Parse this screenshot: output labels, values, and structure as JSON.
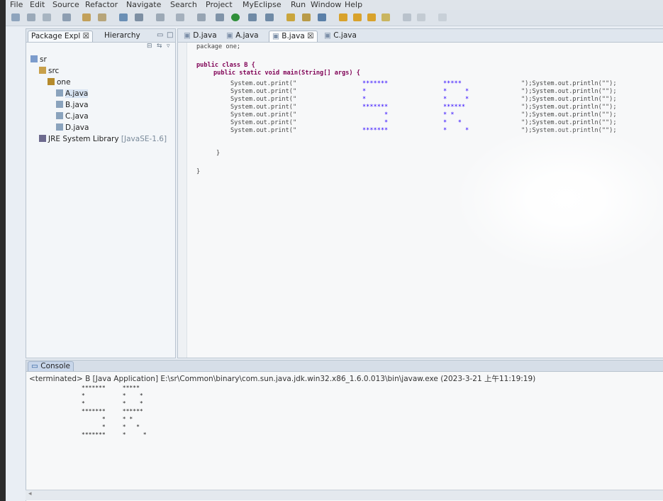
{
  "menubar": [
    "File",
    "Edit",
    "Source",
    "Refactor",
    "Navigate",
    "Search",
    "Project",
    "MyEclipse",
    "Run",
    "Window",
    "Help"
  ],
  "left_panel": {
    "tabs": [
      "Package Expl",
      "Hierarchy"
    ],
    "tree": [
      {
        "label": "sr",
        "icon": "project-icon",
        "indent": 0
      },
      {
        "label": "src",
        "icon": "source-folder-icon",
        "indent": 1
      },
      {
        "label": "one",
        "icon": "package-icon",
        "indent": 2
      },
      {
        "label": "A.java",
        "icon": "java-file-icon",
        "indent": 3,
        "selected": true
      },
      {
        "label": "B.java",
        "icon": "java-file-icon",
        "indent": 3
      },
      {
        "label": "C.java",
        "icon": "java-file-icon",
        "indent": 3
      },
      {
        "label": "D.java",
        "icon": "java-file-icon",
        "indent": 3
      },
      {
        "label": "JRE System Library",
        "suffix": "[JavaSE-1.6]",
        "icon": "library-icon",
        "indent": 1
      }
    ]
  },
  "editor": {
    "tabs": [
      {
        "label": "D.java",
        "active": false
      },
      {
        "label": "A.java",
        "active": false
      },
      {
        "label": "B.java",
        "active": true
      },
      {
        "label": "C.java",
        "active": false
      }
    ],
    "code": {
      "package_line": "package one;",
      "class_line": "public class B {",
      "main_line": "public static void main(String[] args) {",
      "print_prefix": "System.out.print(\"",
      "print_suffix": "\");System.out.println(\"\");",
      "pattern_rows": [
        {
          "left": "*******",
          "right": "*****"
        },
        {
          "left": "*",
          "right": "*     *"
        },
        {
          "left": "*",
          "right": "*     *"
        },
        {
          "left": "*******",
          "right": "******"
        },
        {
          "left": "      *",
          "right": "* *"
        },
        {
          "left": "      *",
          "right": "*   *"
        },
        {
          "left": "*******",
          "right": "*     *"
        }
      ],
      "close_method": "}",
      "close_class": "}"
    }
  },
  "console": {
    "tab_label": "Console",
    "status": "<terminated> B [Java Application] E:\\sr\\Common\\binary\\com.sun.java.jdk.win32.x86_1.6.0.013\\bin\\javaw.exe (2023-3-21 上午11:19:19)",
    "output": [
      "*******     *****",
      "*           *    *",
      "*           *    *",
      "*******     ******",
      "      *     * *",
      "      *     *   *",
      "*******     *     *"
    ]
  }
}
